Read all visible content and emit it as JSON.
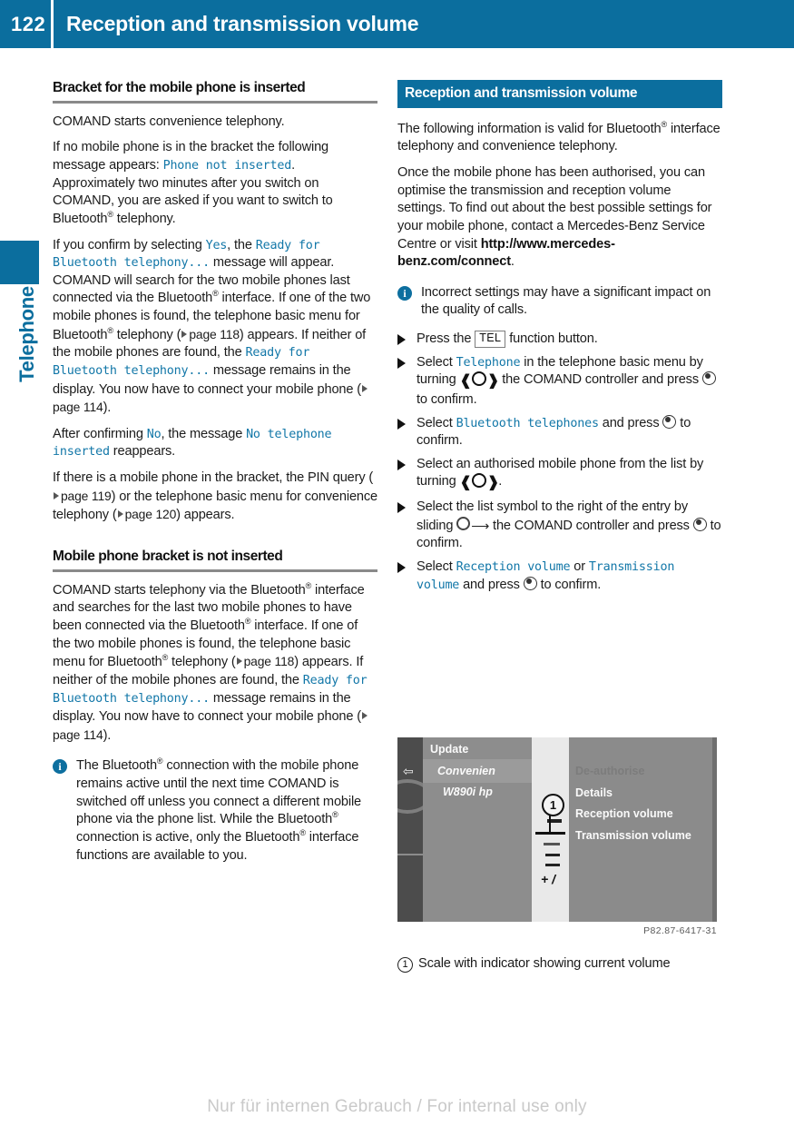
{
  "header": {
    "page_number": "122",
    "title": "Reception and transmission volume"
  },
  "side_tab": {
    "label": "Telephone"
  },
  "left_column": {
    "heading_1": "Bracket for the mobile phone is inserted",
    "para_1": "COMAND starts convenience telephony.",
    "para_2_a": "If no mobile phone is in the bracket the following message appears: ",
    "para_2_mono": "Phone not inserted",
    "para_2_b": ". Approximately two minutes after you switch on COMAND, you are asked if you want to switch to Bluetooth",
    "para_2_c": " telephony.",
    "para_3_a": "If you confirm by selecting ",
    "para_3_mono1": "Yes",
    "para_3_b": ", the ",
    "para_3_mono2": "Ready for Bluetooth telephony...",
    "para_3_c": " message will appear. COMAND will search for the two mobile phones last connected via the Bluetooth",
    "para_3_d": " interface. If one of the two mobile phones is found, the telephone basic menu for Bluetooth",
    "para_3_e": " telephony (",
    "para_3_page1": "page 118",
    "para_3_f": ") appears. If neither of the mobile phones are found, the ",
    "para_3_mono3": "Ready for Bluetooth telephony...",
    "para_3_g": " message remains in the display. You now have to connect your mobile phone (",
    "para_3_page2": "page 114",
    "para_3_h": ").",
    "para_4_a": "After confirming ",
    "para_4_mono1": "No",
    "para_4_b": ", the message ",
    "para_4_mono2": "No telephone inserted",
    "para_4_c": " reappears.",
    "para_5_a": "If there is a mobile phone in the bracket, the PIN query (",
    "para_5_page1": "page 119",
    "para_5_b": ") or the telephone basic menu for convenience telephony (",
    "para_5_page2": "page 120",
    "para_5_c": ") appears.",
    "heading_2": "Mobile phone bracket is not inserted",
    "para_6_a": "COMAND starts telephony via the Bluetooth",
    "para_6_b": " interface and searches for the last two mobile phones to have been connected via the Bluetooth",
    "para_6_c": " interface. If one of the two mobile phones is found, the telephone basic menu for Bluetooth",
    "para_6_d": " telephony (",
    "para_6_page1": "page 118",
    "para_6_e": ") appears. If neither of the mobile phones are found, the ",
    "para_6_mono": "Ready for Bluetooth telephony...",
    "para_6_f": " message remains in the display. You now have to connect your mobile phone (",
    "para_6_page2": "page 114",
    "para_6_g": ").",
    "note_a": "The Bluetooth",
    "note_b": " connection with the mobile phone remains active until the next time COMAND is switched off unless you connect a different mobile phone via the phone list. While the Bluetooth",
    "note_c": " connection is active, only the Bluetooth",
    "note_d": " interface functions are available to you.",
    "info_icon_char": "i"
  },
  "right_column": {
    "heading_banner": "Reception and transmission volume",
    "para_1_a": "The following information is valid for Bluetooth",
    "para_1_b": " interface telephony and convenience telephony.",
    "para_2_a": "Once the mobile phone has been authorised, you can optimise the transmission and reception volume settings. To find out about the best possible settings for your mobile phone, contact a Mercedes-Benz Service Centre or visit ",
    "para_2_url": "http://www.mercedes-benz.com/connect",
    "para_2_b": ".",
    "note": "Incorrect settings may have a significant impact on the quality of calls.",
    "info_icon_char": "i",
    "steps": [
      {
        "before": "Press the ",
        "key": "TEL",
        "after": " function button."
      },
      {
        "before": "Select ",
        "mono": "Telephone",
        "mid": " in the telephone basic menu by turning ",
        "mid2": " the COMAND controller and press ",
        "after": " to confirm."
      },
      {
        "before": "Select ",
        "mono": "Bluetooth telephones",
        "mid": " and press ",
        "after": " to confirm."
      },
      {
        "before": "Select an authorised mobile phone from the list by turning ",
        "after": "."
      },
      {
        "before": "Select the list symbol to the right of the entry by sliding ",
        "mid": " the COMAND controller and press ",
        "after": " to confirm."
      },
      {
        "before": "Select ",
        "mono": "Reception volume",
        "mid": " or ",
        "mono2": "Transmission volume",
        "mid2": " and press ",
        "after": " to confirm."
      }
    ]
  },
  "comand_screenshot": {
    "menu_items": [
      "Update",
      "Convenien",
      "W890i hp"
    ],
    "right_items": [
      "De-authorise",
      "Details",
      "Reception volume",
      "Transmission volume"
    ],
    "scale_plus_label": "+ /",
    "callout_number": "1",
    "image_code": "P82.87-6417-31"
  },
  "caption": {
    "number": "1",
    "text": "Scale with indicator showing current volume"
  },
  "watermark": "Nur für internen Gebrauch / For internal use only",
  "colors": {
    "brand_blue": "#0b6e9e",
    "mono_blue": "#1277a8",
    "heading_rule": "#8a8a8a",
    "watermark_grey": "#c9c9c9"
  }
}
